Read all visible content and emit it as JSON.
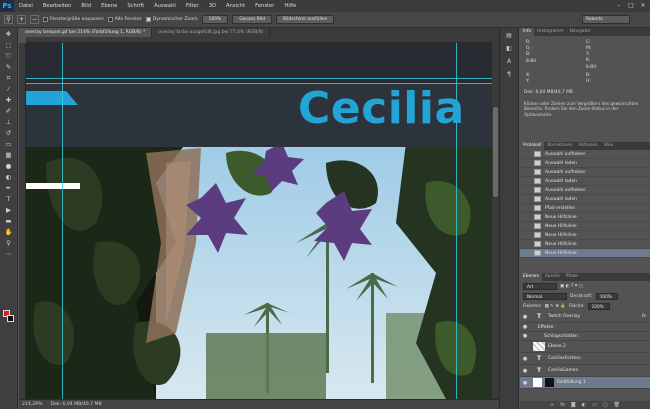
{
  "app": {
    "logo": "Ps"
  },
  "menu": [
    "Datei",
    "Bearbeiten",
    "Bild",
    "Ebene",
    "Schrift",
    "Auswahl",
    "Filter",
    "3D",
    "Ansicht",
    "Fenster",
    "Hilfe"
  ],
  "options": {
    "fit_label": "Fenstergröße anpassen",
    "all_windows_label": "Alle Fenster",
    "dynamic_zoom_label": "Dynamischer Zoom",
    "zoom_100": "100%",
    "whole_image": "Ganzes Bild",
    "fill_screen": "Bildschirm ausfüllen",
    "workspace": "Roberts"
  },
  "tabs": [
    "overlay beispiel.gif bei 214% (Farbfüllung 1, RGB/8) *",
    "overlay farbe ausgefüllt.jpg bei 77,4% (RGB/8)"
  ],
  "canvas": {
    "name": "Cecilia"
  },
  "status": {
    "zoom": "214,29%",
    "doc": "Dok: 6,04 MB/40,7 MB"
  },
  "info": {
    "tabs": [
      "Info",
      "Histogramm",
      "Navigator"
    ],
    "r": "R:",
    "g": "G:",
    "b": "B:",
    "bit1": "8-Bit",
    "c": "C:",
    "m": "M:",
    "y": "Y:",
    "k": "K:",
    "bit2": "8-Bit",
    "x": "X:",
    "yy": "Y:",
    "w": "B:",
    "h": "H:",
    "doc": "Dok: 6,04 MB/40,7 MB",
    "help": "Klicken oder Ziehen zum Vergrößern des gewünschten Bereichs. Ändern Sie den Zoom-Status in der Optionsleiste."
  },
  "history": {
    "tabs": [
      "Protokoll",
      "Korrekturen",
      "Aktionen",
      "Stile"
    ],
    "items": [
      "Auswahl aufheben",
      "Auswahl laden",
      "Auswahl aufheben",
      "Auswahl laden",
      "Auswahl aufheben",
      "Auswahl laden",
      "Pfad erstellen",
      "Neue Hilfslinie",
      "Neue Hilfslinie",
      "Neue Hilfslinie",
      "Neue Hilfslinie",
      "Neue Hilfslinie"
    ]
  },
  "layers": {
    "tabs": [
      "Ebenen",
      "Kanäle",
      "Pfade"
    ],
    "filter": "Art",
    "blend": "Normal",
    "opacity_label": "Deckkraft:",
    "opacity": "100%",
    "lock_label": "Fixieren:",
    "fill_label": "Fläche:",
    "fill": "100%",
    "items": [
      {
        "name": "Twitch Overlay",
        "type": "T",
        "fx": "fx"
      },
      {
        "name": "Effekte",
        "type": "sub"
      },
      {
        "name": "Schlagschatten",
        "type": "sub"
      },
      {
        "name": "Ebene 2",
        "type": "img"
      },
      {
        "name": "CeciliasFortess",
        "type": "T"
      },
      {
        "name": "CeciliaGames",
        "type": "T"
      },
      {
        "name": "Farbfüllung 1",
        "type": "fill"
      }
    ]
  }
}
